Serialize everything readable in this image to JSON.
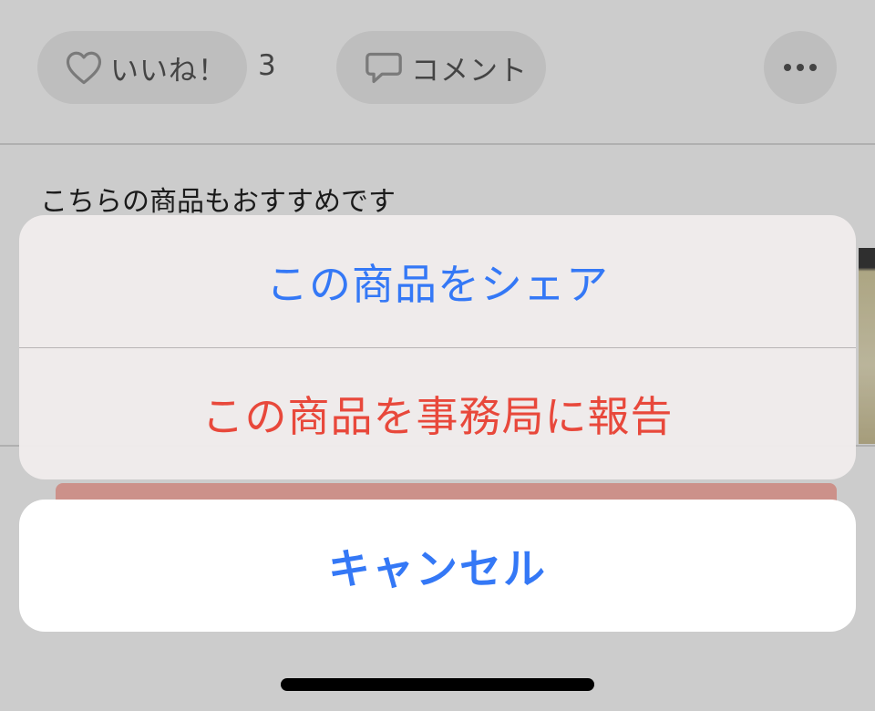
{
  "header": {
    "like_label": "いいね！",
    "like_count": "3",
    "comment_label": "コメント",
    "more_icon": "more-horizontal-icon"
  },
  "recommend": {
    "heading": "こちらの商品もおすすめです"
  },
  "action_sheet": {
    "share_label": "この商品をシェア",
    "report_label": "この商品を事務局に報告",
    "cancel_label": "キャンセル"
  },
  "colors": {
    "action_blue": "#3478f6",
    "destructive_red": "#e8483b",
    "buy_button": "#ffb6ad"
  }
}
